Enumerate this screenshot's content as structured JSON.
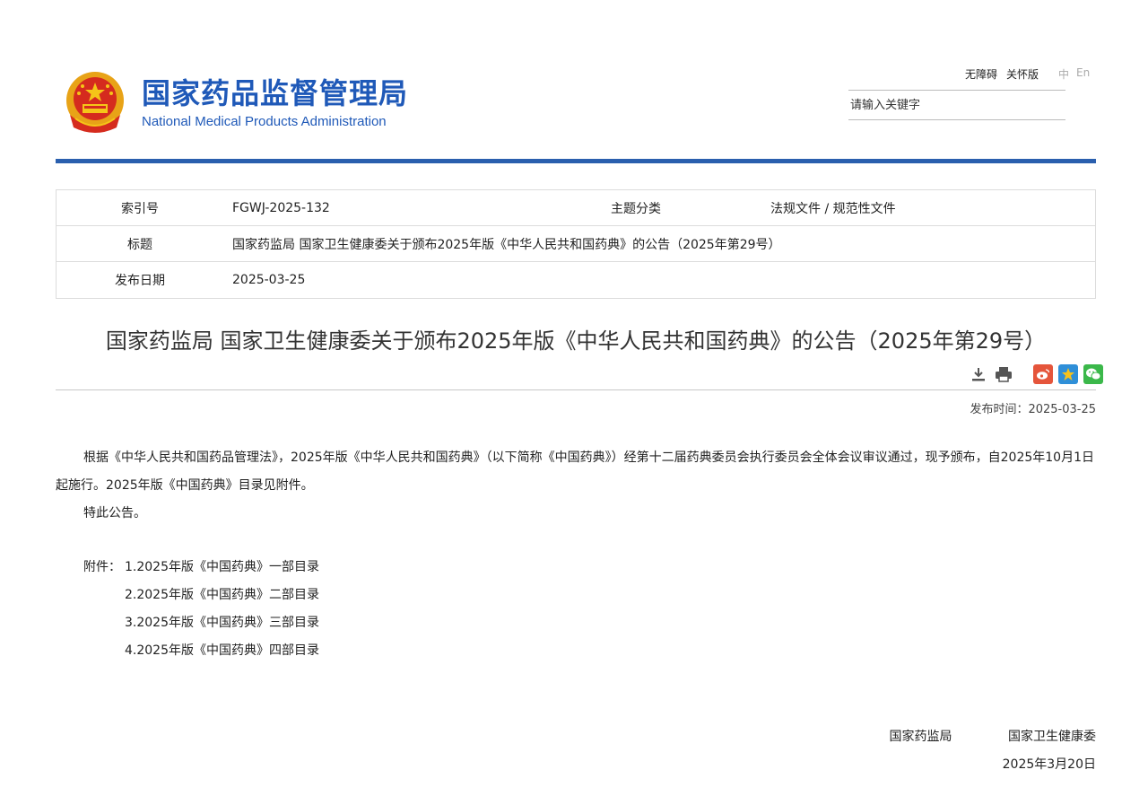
{
  "header": {
    "logo_cn": "国家药品监督管理局",
    "logo_en": "National Medical Products Administration",
    "links": [
      "无障碍",
      "关怀版"
    ],
    "lang": [
      "中",
      "En"
    ],
    "search_placeholder": "请输入关键字",
    "accent": "#2a5fae"
  },
  "info": {
    "index_label": "索引号",
    "index_value": "FGWJ-2025-132",
    "topic_label": "主题分类",
    "topic_value": "法规文件 / 规范性文件",
    "title_label": "标题",
    "title_value": "国家药监局 国家卫生健康委关于颁布2025年版《中华人民共和国药典》的公告（2025年第29号）",
    "date_label": "发布日期",
    "date_value": "2025-03-25"
  },
  "article": {
    "title": "国家药监局 国家卫生健康委关于颁布2025年版《中华人民共和国药典》的公告（2025年第29号）",
    "pubtime": "发布时间：2025-03-25",
    "tools": [
      "download-icon",
      "print-icon",
      "weibo-icon",
      "qzone-icon",
      "wechat-icon"
    ],
    "para1": "根据《中华人民共和国药品管理法》，2025年版《中华人民共和国药典》（以下简称《中国药典》）经第十二届药典委员会执行委员会全体会议审议通过，现予颁布，自2025年10月1日起施行。2025年版《中国药典》目录见附件。",
    "para2": "特此公告。",
    "attach_label": "附件：",
    "attachments": [
      "1.2025年版《中国药典》一部目录",
      "2.2025年版《中国药典》二部目录",
      "3.2025年版《中国药典》三部目录",
      "4.2025年版《中国药典》四部目录"
    ],
    "sign_org1": "国家药监局",
    "sign_org2": "国家卫生健康委",
    "sign_date": "2025年3月20日"
  }
}
